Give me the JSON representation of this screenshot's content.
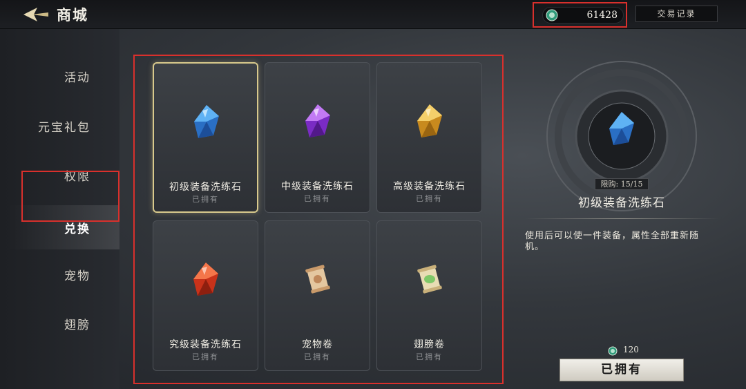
{
  "header": {
    "title": "商城",
    "currency_icon": "jade-coin-icon",
    "currency_value": "61428",
    "history_label": "交易记录"
  },
  "sidebar": {
    "items": [
      {
        "label": "活动",
        "active": false
      },
      {
        "label": "元宝礼包",
        "active": false
      },
      {
        "label": "权限",
        "active": false
      },
      {
        "label": "兑换",
        "active": true
      },
      {
        "label": "宠物",
        "active": false
      },
      {
        "label": "翅膀",
        "active": false
      }
    ]
  },
  "shop": {
    "items": [
      {
        "name": "初级装备洗练石",
        "status": "已拥有",
        "icon": "blue-crystal-icon",
        "color": "#3b8fe0",
        "selected": true
      },
      {
        "name": "中级装备洗练石",
        "status": "已拥有",
        "icon": "purple-crystal-icon",
        "color": "#9b3fe0",
        "selected": false
      },
      {
        "name": "高级装备洗练石",
        "status": "已拥有",
        "icon": "gold-crystal-icon",
        "color": "#e0a533",
        "selected": false
      },
      {
        "name": "究级装备洗练石",
        "status": "已拥有",
        "icon": "red-crystal-icon",
        "color": "#e0431f",
        "selected": false
      },
      {
        "name": "宠物卷",
        "status": "已拥有",
        "icon": "pet-scroll-icon",
        "color": "#d9b48a",
        "selected": false
      },
      {
        "name": "翅膀卷",
        "status": "已拥有",
        "icon": "wing-scroll-icon",
        "color": "#8ed07a",
        "selected": false
      }
    ]
  },
  "detail": {
    "limit": "限购: 15/15",
    "name": "初级装备洗练石",
    "description": "使用后可以使一件装备，属性全部重新随机。",
    "price": "120",
    "button_label": "已拥有"
  }
}
